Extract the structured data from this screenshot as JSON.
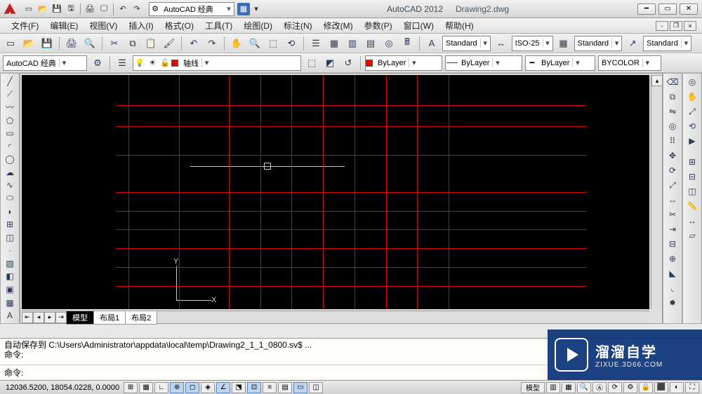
{
  "title": {
    "app": "AutoCAD 2012",
    "file": "Drawing2.dwg"
  },
  "workspace": "AutoCAD 经典",
  "menus": [
    "文件(F)",
    "编辑(E)",
    "视图(V)",
    "插入(I)",
    "格式(O)",
    "工具(T)",
    "绘图(D)",
    "标注(N)",
    "修改(M)",
    "参数(P)",
    "窗口(W)",
    "帮助(H)"
  ],
  "style_combos": {
    "text_style": "Standard",
    "dim_style": "ISO-25",
    "table_style": "Standard",
    "mleader_style": "Standard"
  },
  "row2": {
    "workspace": "AutoCAD 经典",
    "layer_name": "轴线",
    "prop_color": "ByLayer",
    "prop_linetype": "ByLayer",
    "prop_lweight": "ByLayer",
    "prop_bycolor": "BYCOLOR"
  },
  "tabs": {
    "model": "模型",
    "layout1": "布局1",
    "layout2": "布局2"
  },
  "ucs": {
    "y": "Y",
    "x": "X"
  },
  "cmd": {
    "hist_line1": "自动保存到 C:\\Users\\Administrator\\appdata\\local\\temp\\Drawing2_1_1_0800.sv$ ...",
    "hist_line2": "命令:",
    "prompt": "命令:"
  },
  "status": {
    "coords": "12036.5200, 18054.0228, 0.0000",
    "model_label": "模型"
  },
  "watermark": {
    "brand": "溜溜自学",
    "url": "ZIXUE.3D66.COM"
  },
  "grid": {
    "h_positions_pct": [
      13,
      22,
      34,
      50,
      58,
      66,
      74,
      82,
      90
    ],
    "v_positions_pct": [
      17,
      25,
      33,
      38,
      43,
      48,
      53,
      58,
      63,
      68
    ]
  }
}
